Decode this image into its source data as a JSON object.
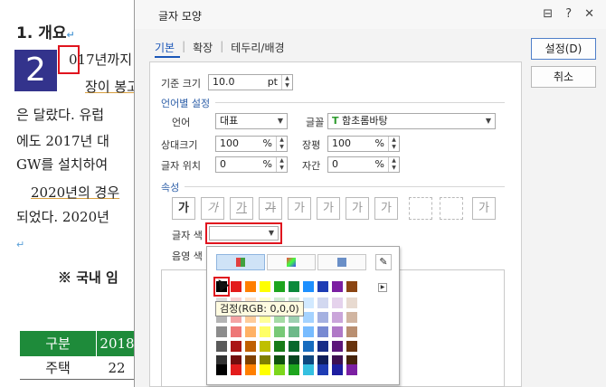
{
  "document": {
    "heading": "1. 개요",
    "drop_cap": "2",
    "lines": [
      "017년까지",
      "장이 봉고",
      "은 달랐다. 유럽",
      "에도 2017년 대",
      "GW를 설치하여",
      "2020년의 경우",
      "되었다. 2020년",
      "※ 국내 임"
    ],
    "return_mark": "↵",
    "table": {
      "headers": [
        "구분",
        "2018"
      ],
      "rows": [
        [
          "주택",
          "22"
        ]
      ]
    }
  },
  "dialog": {
    "title": "글자 모양",
    "titlebar_icons": [
      "⊟",
      "?",
      "✕"
    ],
    "tabs": [
      "기본",
      "확장",
      "테두리/배경"
    ],
    "buttons": {
      "ok": "설정(D)",
      "cancel": "취소"
    },
    "base_size": {
      "label": "기준 크기",
      "value": "10.0",
      "unit": "pt"
    },
    "lang_section": "언어별 설정",
    "language": {
      "label": "언어",
      "value": "대표"
    },
    "font": {
      "label": "글꼴",
      "value": "함초롬바탕"
    },
    "rel_size": {
      "label": "상대크기",
      "value": "100",
      "unit": "%"
    },
    "width_ratio": {
      "label": "장평",
      "value": "100",
      "unit": "%"
    },
    "position": {
      "label": "글자 위치",
      "value": "0",
      "unit": "%"
    },
    "spacing": {
      "label": "자간",
      "value": "0",
      "unit": "%"
    },
    "attr_section": "속성",
    "attr_buttons": [
      "가",
      "가",
      "가",
      "가",
      "가",
      "가",
      "가",
      "가",
      "",
      "",
      "가"
    ],
    "text_color_label": "글자 색",
    "shade_color_label": "음영 색",
    "tooltip": "검정(RGB: 0,0,0)"
  },
  "colors": {
    "accent": "#1a56b8",
    "drop_cap_bg": "#33338c",
    "table_header": "#1e8b3a",
    "highlight": "#e0141e",
    "top_row": [
      "#000000",
      "#e31c1c",
      "#ff7f00",
      "#ffff00",
      "#1ea51e",
      "#0b8a3b",
      "#1e90ff",
      "#1e3cb4",
      "#7b1fa2",
      "#8b4513"
    ],
    "bottom_row": [
      "#000000",
      "#e31c1c",
      "#ff7f00",
      "#ffff00",
      "#7cd61c",
      "#1ea51e",
      "#35c0e0",
      "#1e3cb4",
      "#1e1ea0",
      "#7b1fa2"
    ]
  }
}
